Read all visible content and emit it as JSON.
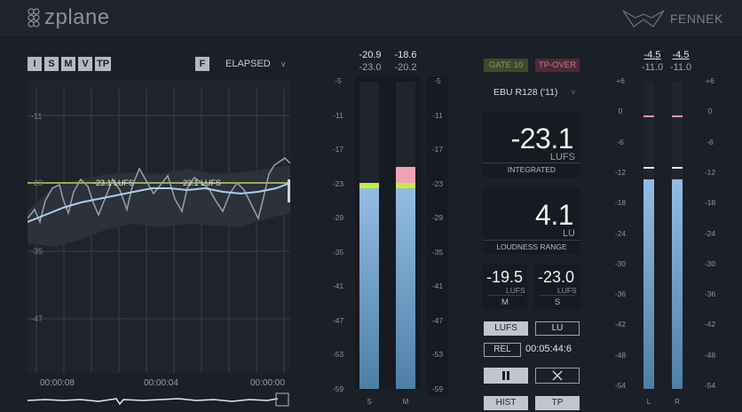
{
  "header": {
    "brand": "zplane",
    "product": "FENNEK"
  },
  "toolbar": {
    "mode_buttons": [
      "I",
      "S",
      "M",
      "V",
      "TP"
    ],
    "f_button": "F",
    "elapsed_select": "ELAPSED"
  },
  "graph": {
    "y_labels": [
      "-11",
      "-23",
      "-35",
      "-47"
    ],
    "annotations": [
      "-23.1 LUFS",
      "-23.1 LUFS"
    ],
    "time_labels": [
      "00:00:08",
      "00:00:04",
      "00:00:00"
    ],
    "colors": {
      "integrated_line": "#b9d45a",
      "momentary": "#9aa1ab",
      "short_term": "#a8d0ee"
    }
  },
  "left_meter": {
    "values_top": [
      "-20.9",
      "-18.6"
    ],
    "values_bottom": [
      "-23.0",
      "-20.2"
    ],
    "scale": [
      "-5",
      "-11",
      "-17",
      "-23",
      "-29",
      "-35",
      "-41",
      "-47",
      "-53",
      "-59"
    ],
    "bar_labels": [
      "S",
      "M"
    ],
    "levels": {
      "S": -23.0,
      "M": -23.0,
      "S_peak_hold": -23.0,
      "M_over": -18.6
    }
  },
  "center": {
    "gate_label": "GATE 10",
    "tp_over_label": "TP-OVER",
    "standard": "EBU R128 ('11)",
    "integrated": {
      "value": "-23.1",
      "unit": "LUFS",
      "caption": "INTEGRATED"
    },
    "loudness_range": {
      "value": "4.1",
      "unit": "LU",
      "caption": "LOUDNESS RANGE"
    },
    "momentary": {
      "value": "-19.5",
      "unit": "LUFS",
      "caption": "M"
    },
    "short_term": {
      "value": "-23.0",
      "unit": "LUFS",
      "caption": "S"
    },
    "unit_buttons": [
      "LUFS",
      "LU"
    ],
    "rel_button": "REL",
    "elapsed_time": "00:05:44:6",
    "hist_button": "HIST",
    "tp_button": "TP"
  },
  "right_meter": {
    "values_top": [
      "-4.5",
      "-4.5"
    ],
    "values_bottom": [
      "-11.0",
      "-11.0"
    ],
    "scale": [
      "+6",
      "0",
      "-6",
      "-12",
      "-18",
      "-24",
      "-30",
      "-36",
      "-42",
      "-48",
      "-54"
    ],
    "bar_labels": [
      "L",
      "R"
    ],
    "levels": {
      "L": -11.0,
      "R": -11.0
    }
  }
}
